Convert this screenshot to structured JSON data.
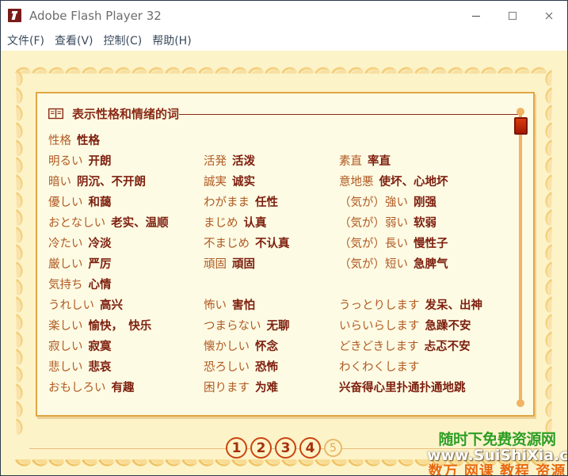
{
  "window": {
    "title": "Adobe Flash Player 32",
    "app_icon": "flash-icon",
    "minimize_label": "—",
    "maximize_label": "□",
    "close_label": "✕"
  },
  "menu": {
    "items": [
      {
        "label": "文件(F)"
      },
      {
        "label": "查看(V)"
      },
      {
        "label": "控制(C)"
      },
      {
        "label": "帮助(H)"
      }
    ]
  },
  "card": {
    "icon": "open-book-icon",
    "title": "表示性格和情绪的词",
    "rows": [
      {
        "a_jp": "性格",
        "a_cn": "性格",
        "b_jp": "",
        "b_cn": "",
        "c_jp": "",
        "c_cn": ""
      },
      {
        "a_jp": "明るい",
        "a_cn": "开朗",
        "b_jp": "活発",
        "b_cn": "活泼",
        "c_jp": "素直",
        "c_cn": "率直"
      },
      {
        "a_jp": "暗い",
        "a_cn": "阴沉、不开朗",
        "b_jp": "誠実",
        "b_cn": "诚实",
        "c_jp": "意地悪",
        "c_cn": "使坏、心地坏"
      },
      {
        "a_jp": "優しい",
        "a_cn": "和藹",
        "b_jp": "わがまま",
        "b_cn": "任性",
        "c_jp": "（気が）強い",
        "c_cn": "刚强"
      },
      {
        "a_jp": "おとなしい",
        "a_cn": "老实、温顺",
        "b_jp": "まじめ",
        "b_cn": "认真",
        "c_jp": "（気が）弱い",
        "c_cn": "软弱"
      },
      {
        "a_jp": "冷たい",
        "a_cn": "冷淡",
        "b_jp": "不まじめ",
        "b_cn": "不认真",
        "c_jp": "（気が）長い",
        "c_cn": "慢性子"
      },
      {
        "a_jp": "厳しい",
        "a_cn": "严厉",
        "b_jp": "頑固",
        "b_cn": "頑固",
        "c_jp": "（気が）短い",
        "c_cn": "急脾气"
      },
      {
        "a_jp": "気持ち",
        "a_cn": "心情",
        "b_jp": "",
        "b_cn": "",
        "c_jp": "",
        "c_cn": ""
      },
      {
        "a_jp": "うれしい",
        "a_cn": "高兴",
        "b_jp": "怖い",
        "b_cn": "害怕",
        "c_jp": "うっとりします",
        "c_cn": "发呆、出神"
      },
      {
        "a_jp": "楽しい",
        "a_cn": "愉快，　快乐",
        "b_jp": "つまらない",
        "b_cn": "无聊",
        "c_jp": "いらいらします",
        "c_cn": "急躁不安"
      },
      {
        "a_jp": "寂しい",
        "a_cn": "寂寞",
        "b_jp": "懐かしい",
        "b_cn": "怀念",
        "c_jp": "どきどきします",
        "c_cn": "忐忑不安"
      },
      {
        "a_jp": "悲しい",
        "a_cn": "悲哀",
        "b_jp": "恐ろしい",
        "b_cn": "恐怖",
        "c_jp": "わくわくします",
        "c_cn": ""
      },
      {
        "a_jp": "おもしろい",
        "a_cn": "有趣",
        "b_jp": "困ります",
        "b_cn": "为难",
        "c_jp": "",
        "c_cn": "兴奋得心里扑通扑通地跳"
      }
    ]
  },
  "scrollbar": {
    "name": "vertical-scrollbar",
    "thumb_position_percent": 4
  },
  "pager": {
    "pages": [
      {
        "label": "1",
        "state": "active"
      },
      {
        "label": "2",
        "state": "active"
      },
      {
        "label": "3",
        "state": "active"
      },
      {
        "label": "4",
        "state": "active"
      },
      {
        "label": "5",
        "state": "dim"
      }
    ]
  },
  "watermark": {
    "line1": "随时下免费资源网",
    "line2": "www.SuiShiXia.com",
    "line3": "数万 网课 教程 资源"
  },
  "colors": {
    "stage_bg": "#fdf3c8",
    "card_bg": "#fdfbe4",
    "card_border": "#e0a645",
    "jp_text": "#b05a23",
    "cn_text": "#7d1f0e",
    "title_text": "#8a2a16",
    "accent_red": "#c9450f",
    "scroll_track": "#f0b463",
    "watermark_green": "#2f9e20",
    "watermark_orange": "#e86a10"
  }
}
